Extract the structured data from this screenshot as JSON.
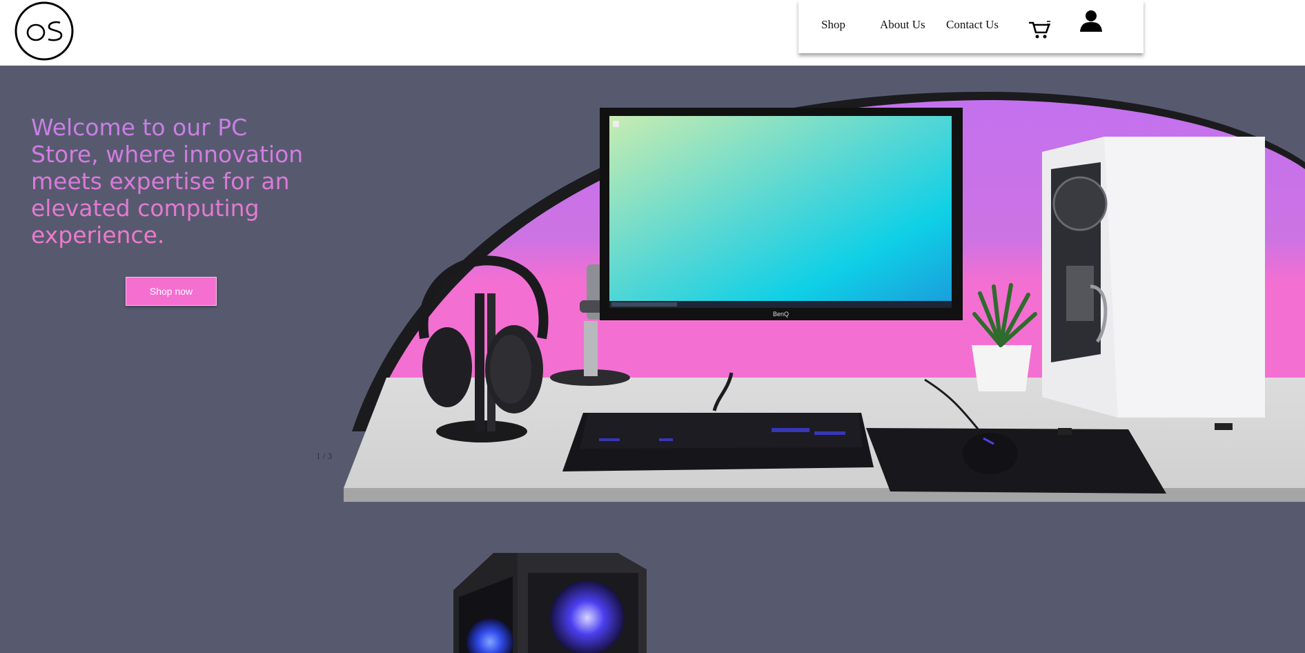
{
  "header": {
    "logo_text": "OS",
    "nav": {
      "shop": "Shop",
      "about": "About Us",
      "contact": "Contact Us"
    },
    "icons": {
      "cart": "cart-icon",
      "user": "user-icon"
    }
  },
  "hero": {
    "welcome": "Welcome to our PC Store, where innovation meets expertise for an elevated computing experience.",
    "cta": "Shop now",
    "slide_counter": "1 / 3"
  },
  "colors": {
    "page_bg": "#575a6f",
    "accent_pink": "#f56fd0",
    "accent_purple": "#c473ee",
    "header_bg": "#ffffff"
  }
}
